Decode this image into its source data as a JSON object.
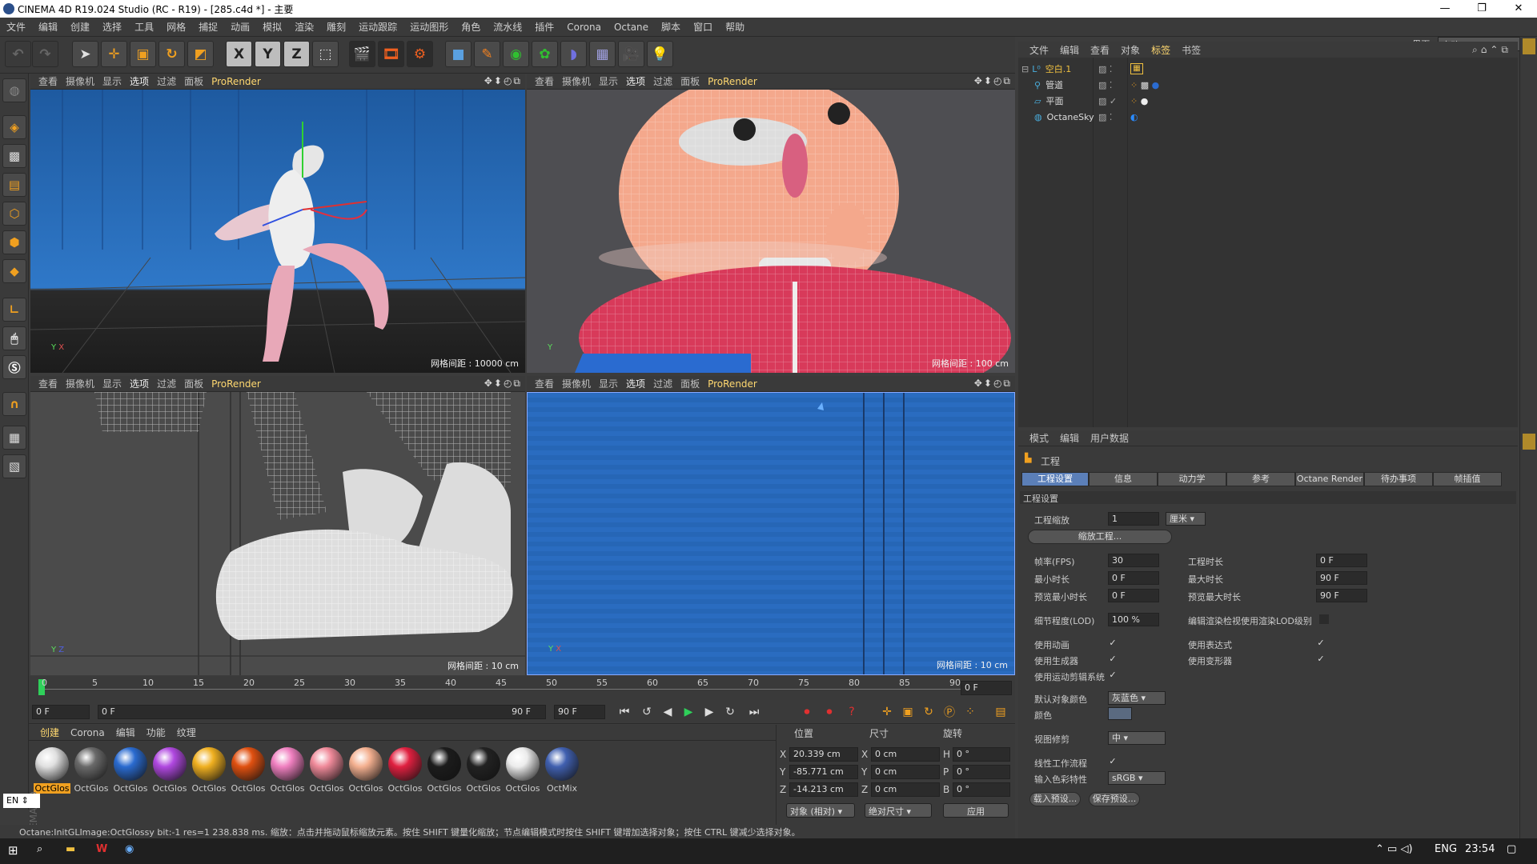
{
  "window": {
    "title": "CINEMA 4D R19.024 Studio (RC - R19) - [285.c4d *] - 主要",
    "minimize": "—",
    "maximize": "❐",
    "close": "✕"
  },
  "menu": [
    "文件",
    "编辑",
    "创建",
    "选择",
    "工具",
    "网格",
    "捕捉",
    "动画",
    "模拟",
    "渲染",
    "雕刻",
    "运动跟踪",
    "运动图形",
    "角色",
    "流水线",
    "插件",
    "Corona",
    "Octane",
    "脚本",
    "窗口",
    "帮助"
  ],
  "layout": {
    "label": "界面:",
    "value": "启动"
  },
  "toolbar": {
    "buttons": [
      "undo-icon",
      "redo-icon",
      "select-arrow-icon",
      "move-icon",
      "scale-icon",
      "rotate-icon",
      "recent-tool-icon",
      "x-axis-icon",
      "y-axis-icon",
      "z-axis-icon",
      "world-coord-icon",
      "render-region-icon",
      "render-view-icon",
      "render-settings-icon",
      "cube-icon",
      "pen-icon",
      "subdivision-icon",
      "cloner-icon",
      "deformer-icon",
      "floor-icon",
      "camera-icon",
      "light-icon"
    ],
    "axis_labels": [
      "X",
      "Y",
      "Z"
    ]
  },
  "viewport_menu": [
    "查看",
    "摄像机",
    "显示",
    "选项",
    "过滤",
    "面板"
  ],
  "viewports": [
    {
      "renderer": "ProRender",
      "grid": "网格间距 : 10000 cm",
      "active": "选项"
    },
    {
      "renderer": "ProRender",
      "grid": "网格间距 : 100 cm",
      "active": "选项"
    },
    {
      "renderer": "ProRender",
      "grid": "网格间距 : 10 cm",
      "active": "选项"
    },
    {
      "renderer": "ProRender",
      "grid": "网格间距 : 10 cm",
      "active": "选项"
    }
  ],
  "axis": {
    "x": "X",
    "y": "Y",
    "z": "Z"
  },
  "timeline": {
    "ticks": [
      "0",
      "5",
      "10",
      "15",
      "20",
      "25",
      "30",
      "35",
      "40",
      "45",
      "50",
      "55",
      "60",
      "65",
      "70",
      "75",
      "80",
      "85",
      "90"
    ],
    "current": "0 F"
  },
  "transport": {
    "start": "0 F",
    "range_start": "0 F",
    "range_end": "90 F",
    "end": "90 F"
  },
  "material_menu": [
    "创建",
    "Corona",
    "编辑",
    "功能",
    "纹理"
  ],
  "materials": [
    {
      "label": "OctGlos",
      "color": "#e0e0e0"
    },
    {
      "label": "OctGlos",
      "color": "#6a6a6a"
    },
    {
      "label": "OctGlos",
      "color": "#2a6bd0"
    },
    {
      "label": "OctGlos",
      "color": "#b048e0"
    },
    {
      "label": "OctGlos",
      "color": "#f0b020"
    },
    {
      "label": "OctGlos",
      "color": "#e05010"
    },
    {
      "label": "OctGlos",
      "color": "#f080c0"
    },
    {
      "label": "OctGlos",
      "color": "#f08a9a"
    },
    {
      "label": "OctGlos",
      "color": "#f4b090"
    },
    {
      "label": "OctGlos",
      "color": "#e02040"
    },
    {
      "label": "OctGlos",
      "color": "#1c1c1c"
    },
    {
      "label": "OctGlos",
      "color": "#222222"
    },
    {
      "label": "OctGlos",
      "color": "#ececec"
    },
    {
      "label": "OctMix",
      "color": "#4060b0"
    }
  ],
  "coords": {
    "headers": [
      "位置",
      "尺寸",
      "旋转"
    ],
    "rows": [
      {
        "axis": "X",
        "pos": "20.339 cm",
        "size_axis": "X",
        "size": "0 cm",
        "rot_axis": "H",
        "rot": "0 °"
      },
      {
        "axis": "Y",
        "pos": "-85.771 cm",
        "size_axis": "Y",
        "size": "0 cm",
        "rot_axis": "P",
        "rot": "0 °"
      },
      {
        "axis": "Z",
        "pos": "-14.213 cm",
        "size_axis": "Z",
        "size": "0 cm",
        "rot_axis": "B",
        "rot": "0 °"
      }
    ],
    "mode": "对象 (相对)",
    "size_mode": "绝对尺寸",
    "apply": "应用"
  },
  "object_manager": {
    "menu": [
      "文件",
      "编辑",
      "查看",
      "对象",
      "标签",
      "书签"
    ],
    "objects": [
      {
        "name": "空白.1",
        "color": "#f0c040"
      },
      {
        "name": "管道",
        "color": "#ddd"
      },
      {
        "name": "平面",
        "color": "#ddd"
      },
      {
        "name": "OctaneSky",
        "color": "#ddd"
      }
    ]
  },
  "attr_manager": {
    "menu": [
      "模式",
      "编辑",
      "用户数据"
    ],
    "title": "工程",
    "tabs": [
      "工程设置",
      "信息",
      "动力学",
      "参考",
      "Octane Render",
      "待办事项",
      "帧插值"
    ],
    "section": "工程设置",
    "project_scale_label": "工程缩放",
    "project_scale": "1",
    "project_scale_unit": "厘米",
    "scale_button": "缩放工程...",
    "fps_label": "帧率(FPS)",
    "fps": "30",
    "project_time_label": "工程时长",
    "project_time": "0 F",
    "min_time_label": "最小时长",
    "min_time": "0 F",
    "max_time_label": "最大时长",
    "max_time": "90 F",
    "preview_min_label": "预览最小时长",
    "preview_min": "0 F",
    "preview_max_label": "预览最大时长",
    "preview_max": "90 F",
    "lod_label": "细节程度(LOD)",
    "lod": "100 %",
    "render_lod_label": "编辑渲染检视使用渲染LOD级别",
    "use_anim_label": "使用动画",
    "use_expr_label": "使用表达式",
    "use_gen_label": "使用生成器",
    "use_deform_label": "使用变形器",
    "use_motion_label": "使用运动剪辑系统",
    "default_color_label": "默认对象颜色",
    "default_color": "灰蓝色",
    "color_label": "颜色",
    "view_clip_label": "视图修剪",
    "view_clip": "中",
    "linear_label": "线性工作流程",
    "input_color_label": "输入色彩特性",
    "input_color": "sRGB",
    "load_preset": "载入预设...",
    "save_preset": "保存预设..."
  },
  "status": "Octane:InitGLImage:OctGlossy  bit:-1 res=1  238.838 ms.    缩放：点击并拖动鼠标缩放元素。按住 SHIFT 键量化缩放；节点编辑模式时按住 SHIFT 键增加选择对象；按住 CTRL 键减少选择对象。",
  "ime": "EN",
  "taskbar": {
    "lang": "ENG",
    "time": "23:54"
  }
}
